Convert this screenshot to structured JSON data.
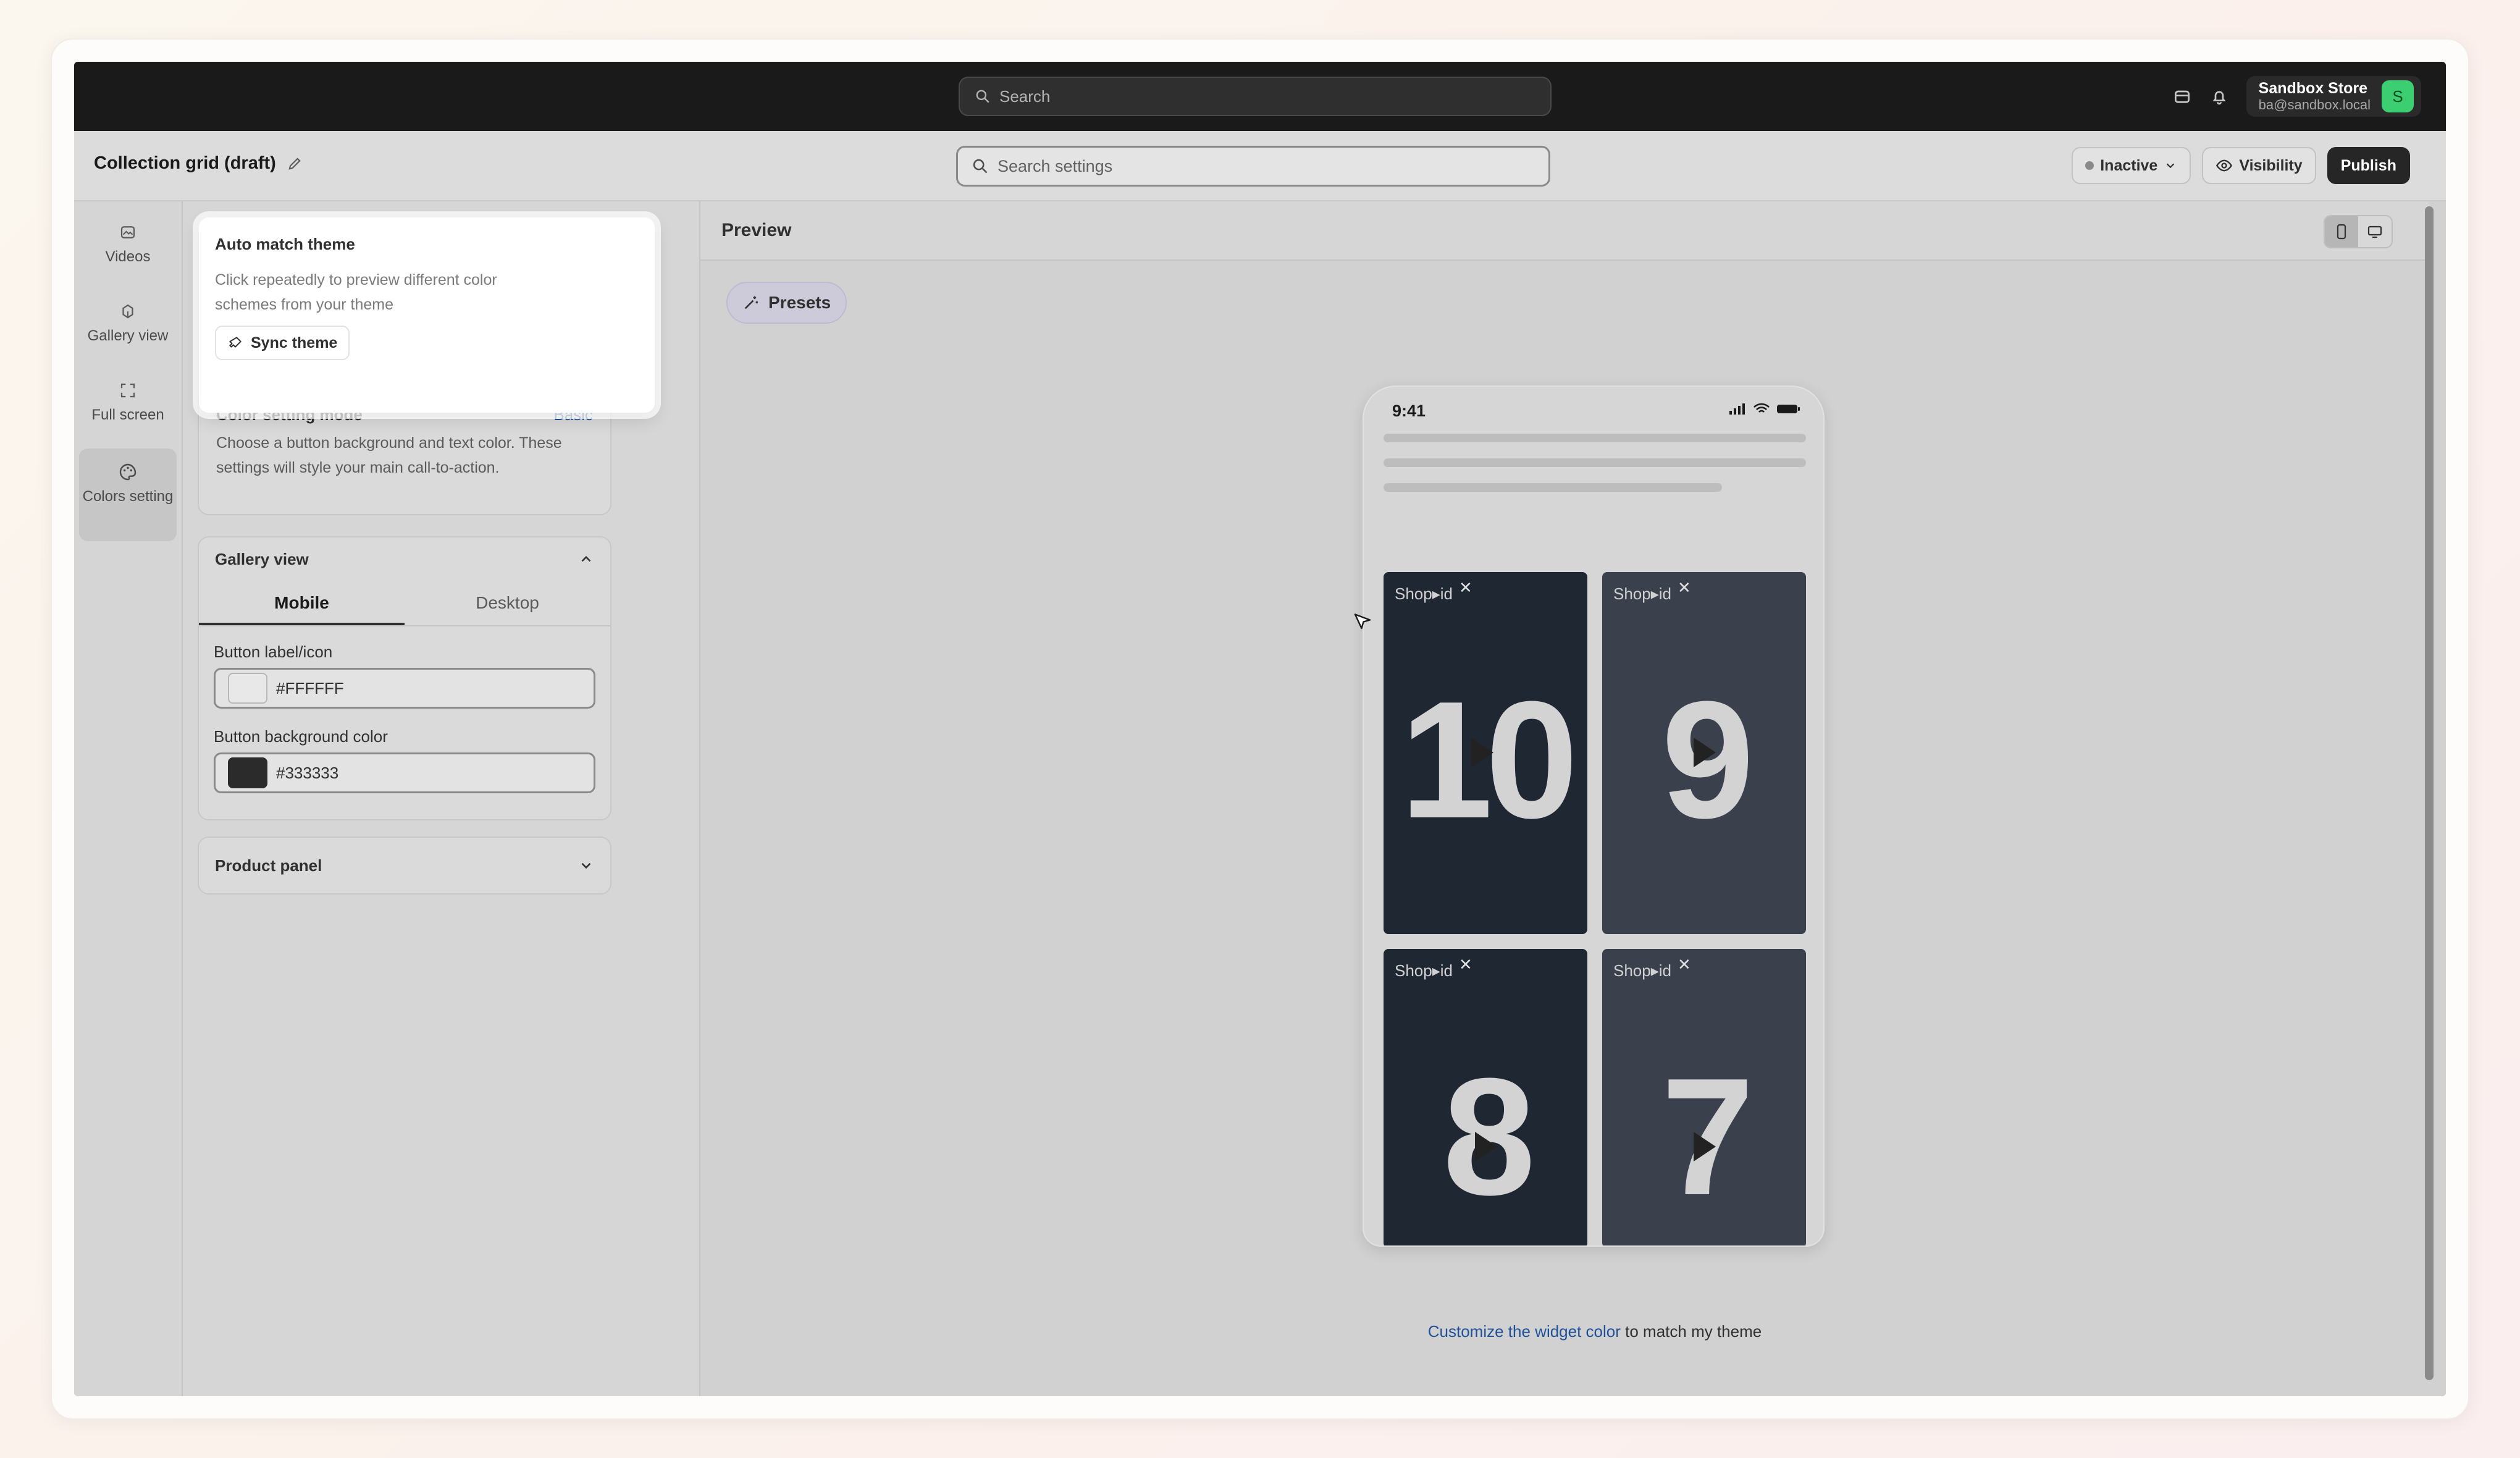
{
  "topbar": {
    "search_placeholder": "Search",
    "store_name": "Sandbox Store",
    "store_email": "ba@sandbox.local",
    "avatar_letter": "S",
    "icons": [
      "store-icon",
      "bell-icon"
    ]
  },
  "subheader": {
    "title": "Collection grid (draft)",
    "settings_search_placeholder": "Search settings",
    "status_label": "Inactive",
    "visibility_label": "Visibility",
    "publish_label": "Publish"
  },
  "rail": {
    "items": [
      {
        "label": "Videos",
        "icon": "video-icon"
      },
      {
        "label": "Gallery view",
        "icon": "gallery-icon"
      },
      {
        "label": "Full screen",
        "icon": "fullscreen-icon"
      },
      {
        "label": "Colors setting",
        "icon": "palette-icon",
        "active": true
      }
    ]
  },
  "popover": {
    "title": "Auto match theme",
    "description": "Click repeatedly to preview different color schemes from your theme",
    "sync_label": "Sync theme"
  },
  "color_mode": {
    "title": "Color setting mode",
    "mode_link": "Basic",
    "description": "Choose a button background and text color. These settings will style your main call-to-action."
  },
  "gallery_view": {
    "title": "Gallery view",
    "tabs": [
      "Mobile",
      "Desktop"
    ],
    "active_tab": "Mobile",
    "fields": [
      {
        "label": "Button label/icon",
        "value": "#FFFFFF",
        "swatch": "#e8e8e8"
      },
      {
        "label": "Button background color",
        "value": "#333333",
        "swatch": "#2b2b2b"
      }
    ]
  },
  "product_panel": {
    "title": "Product panel"
  },
  "preview": {
    "title": "Preview",
    "presets_label": "Presets",
    "phone_time": "9:41",
    "tile_brand": "Shop▸id",
    "tiles": [
      {
        "number": "10",
        "bg": "#1f2733"
      },
      {
        "number": "9",
        "bg": "#3a404c"
      },
      {
        "number": "8",
        "bg": "#1f2733"
      },
      {
        "number": "7",
        "bg": "#3a404c"
      }
    ],
    "caption_link": "Customize the widget color",
    "caption_rest": " to match my theme"
  }
}
